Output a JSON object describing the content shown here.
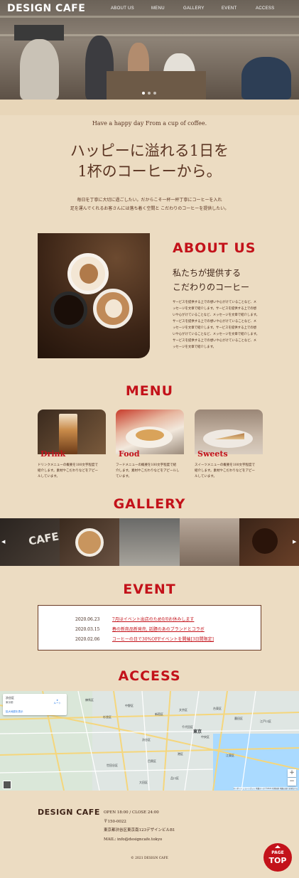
{
  "header": {
    "logo": "DESIGN CAFE",
    "nav": [
      "ABOUT US",
      "MENU",
      "GALLERY",
      "EVENT",
      "ACCESS"
    ]
  },
  "intro": {
    "tagline": "Have a happy day From a cup of coffee.",
    "headline_1": "ハッピーに溢れる1日を",
    "headline_2": "1杯のコーヒーから。",
    "lead_1": "毎日を丁寧に大切に過ごしたい。だからこそ一杯一杯丁寧にコーヒーを入れ",
    "lead_2": "足を運んでくれるお客さんには落ち着く空間と こだわりのコーヒーを提供したい。"
  },
  "about": {
    "title": "ABOUT US",
    "sub_1": "私たちが提供する",
    "sub_2": "こだわりのコーヒー",
    "body": [
      "サービスを提供する上での想いや心がけていることなど、メ",
      "ッセージを文章で紹介します。サービスを提供する上での想",
      "いや心がけていることなど、メッセージを文章で紹介します。",
      "サービスを提供する上での想いや心がけていることなど、メ",
      "ッセージを文章で紹介します。サービスを提供する上での想",
      "いや心がけていることなど、メッセージを文章で紹介します。",
      "サービスを提供する上での想いや心がけていることなど、メ",
      "ッセージを文章で紹介します。"
    ]
  },
  "menu": {
    "title": "MENU",
    "items": [
      {
        "label": "Drink",
        "desc_1": "ドリンクメニューの概要を100文字程度で",
        "desc_2": "紹介します。素材やこだわりなどをアピー",
        "desc_3": "ルしています。"
      },
      {
        "label": "Food",
        "desc_1": "フードメニューの概要を100文字程度で紹",
        "desc_2": "介します。素材やこだわりなどをアピールし",
        "desc_3": "ています。"
      },
      {
        "label": "Sweets",
        "desc_1": "スイーツメニューの概要を100文字程度で",
        "desc_2": "紹介します。素材やこだわりなどをアピー",
        "desc_3": "ルしています。"
      }
    ]
  },
  "gallery": {
    "title": "GALLERY",
    "cafe_sign": "CAFE"
  },
  "event": {
    "title": "EVENT",
    "items": [
      {
        "date": "2020.06.23",
        "text": "7月はイベント出店のため0/0お休みします"
      },
      {
        "date": "2020.03.15",
        "text": "春の新商品新発売, 話題のあのブランドとコラボ"
      },
      {
        "date": "2020.02.06",
        "text": "コーヒーの日で30%OFFイベントを開催[3日間限定]"
      }
    ]
  },
  "access": {
    "title": "ACCESS",
    "map_place": "渋谷区",
    "map_sub": "東京都",
    "map_route": "ルート",
    "map_link": "拡大地図を表示",
    "labels": [
      "中野区",
      "新宿区",
      "杉並区",
      "渋谷区",
      "千代田区",
      "中央区",
      "東京",
      "港区",
      "目黒区",
      "世田谷区",
      "品川区",
      "江東区",
      "江戸川区",
      "練馬区",
      "文京区",
      "台東区",
      "墨田区",
      "大田区"
    ],
    "zoom_in": "+",
    "zoom_out": "−",
    "credit": "キーボード ショートカット  地図データ ©2021  利用規約  地図の誤りを報告する"
  },
  "footer": {
    "logo": "DESIGN CAFE",
    "hours": "OPEN 18:00 / CLOSE 24:00",
    "zip": "〒150-0022",
    "address": "東京都渋谷区東京南123デザインビルB1",
    "mail": "MAIL: info@designcafe.tokyo",
    "copyright": "© 2021 DESIGN CAFE",
    "pagetop_1": "PAGE",
    "pagetop_2": "TOP"
  },
  "colors": {
    "background": "#ecdcc2",
    "accent": "#c3121a",
    "text": "#4a2a1a"
  }
}
